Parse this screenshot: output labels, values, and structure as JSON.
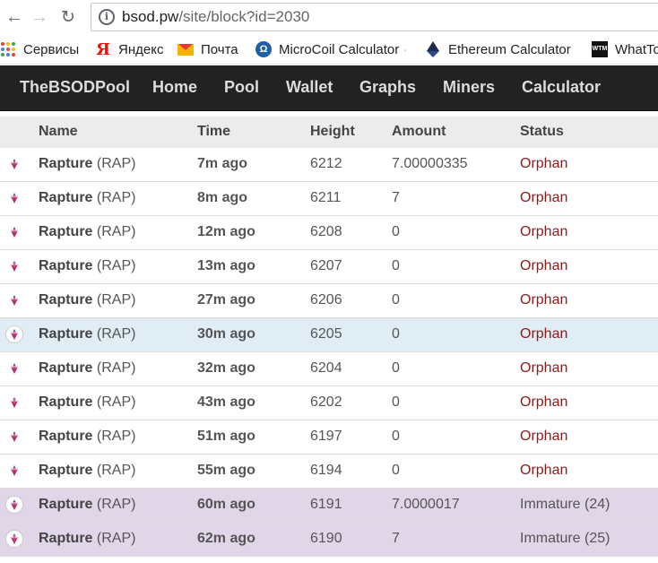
{
  "browser": {
    "url_host": "bsod.pw",
    "url_path": "/site/block?id=2030"
  },
  "bookmarks": [
    {
      "label": "Сервисы",
      "icon": "apps-icon"
    },
    {
      "label": "Яндекс",
      "icon": "yandex-icon"
    },
    {
      "label": "Почта",
      "icon": "mail-icon"
    },
    {
      "label": "MicroCoil Calculator",
      "icon": "microcoil-icon"
    },
    {
      "label": "Ethereum Calculator",
      "icon": "ethereum-icon"
    },
    {
      "label": "WhatTo",
      "icon": "wtm-icon"
    }
  ],
  "site_nav": {
    "brand": "TheBSODPool",
    "links": [
      "Home",
      "Pool",
      "Wallet",
      "Graphs",
      "Miners",
      "Calculator"
    ]
  },
  "table": {
    "headers": [
      "Name",
      "Time",
      "Height",
      "Amount",
      "Status"
    ],
    "rows": [
      {
        "coin": "Rapture",
        "symbol": "(RAP)",
        "time": "7m ago",
        "height": "6212",
        "amount": "7.00000335",
        "status": "Orphan"
      },
      {
        "coin": "Rapture",
        "symbol": "(RAP)",
        "time": "8m ago",
        "height": "6211",
        "amount": "7",
        "status": "Orphan"
      },
      {
        "coin": "Rapture",
        "symbol": "(RAP)",
        "time": "12m ago",
        "height": "6208",
        "amount": "0",
        "status": "Orphan"
      },
      {
        "coin": "Rapture",
        "symbol": "(RAP)",
        "time": "13m ago",
        "height": "6207",
        "amount": "0",
        "status": "Orphan"
      },
      {
        "coin": "Rapture",
        "symbol": "(RAP)",
        "time": "27m ago",
        "height": "6206",
        "amount": "0",
        "status": "Orphan"
      },
      {
        "coin": "Rapture",
        "symbol": "(RAP)",
        "time": "30m ago",
        "height": "6205",
        "amount": "0",
        "status": "Orphan"
      },
      {
        "coin": "Rapture",
        "symbol": "(RAP)",
        "time": "32m ago",
        "height": "6204",
        "amount": "0",
        "status": "Orphan"
      },
      {
        "coin": "Rapture",
        "symbol": "(RAP)",
        "time": "43m ago",
        "height": "6202",
        "amount": "0",
        "status": "Orphan"
      },
      {
        "coin": "Rapture",
        "symbol": "(RAP)",
        "time": "51m ago",
        "height": "6197",
        "amount": "0",
        "status": "Orphan"
      },
      {
        "coin": "Rapture",
        "symbol": "(RAP)",
        "time": "55m ago",
        "height": "6194",
        "amount": "0",
        "status": "Orphan"
      },
      {
        "coin": "Rapture",
        "symbol": "(RAP)",
        "time": "60m ago",
        "height": "6191",
        "amount": "7.0000017",
        "status": "Immature (24)"
      },
      {
        "coin": "Rapture",
        "symbol": "(RAP)",
        "time": "62m ago",
        "height": "6190",
        "amount": "7",
        "status": "Immature (25)"
      }
    ]
  },
  "colors": {
    "navbar_bg": "#222222",
    "orphan_status": "#8b1a1a",
    "immature_row_bg": "#e1d5e8",
    "hover_row_bg": "#e0edf5"
  }
}
